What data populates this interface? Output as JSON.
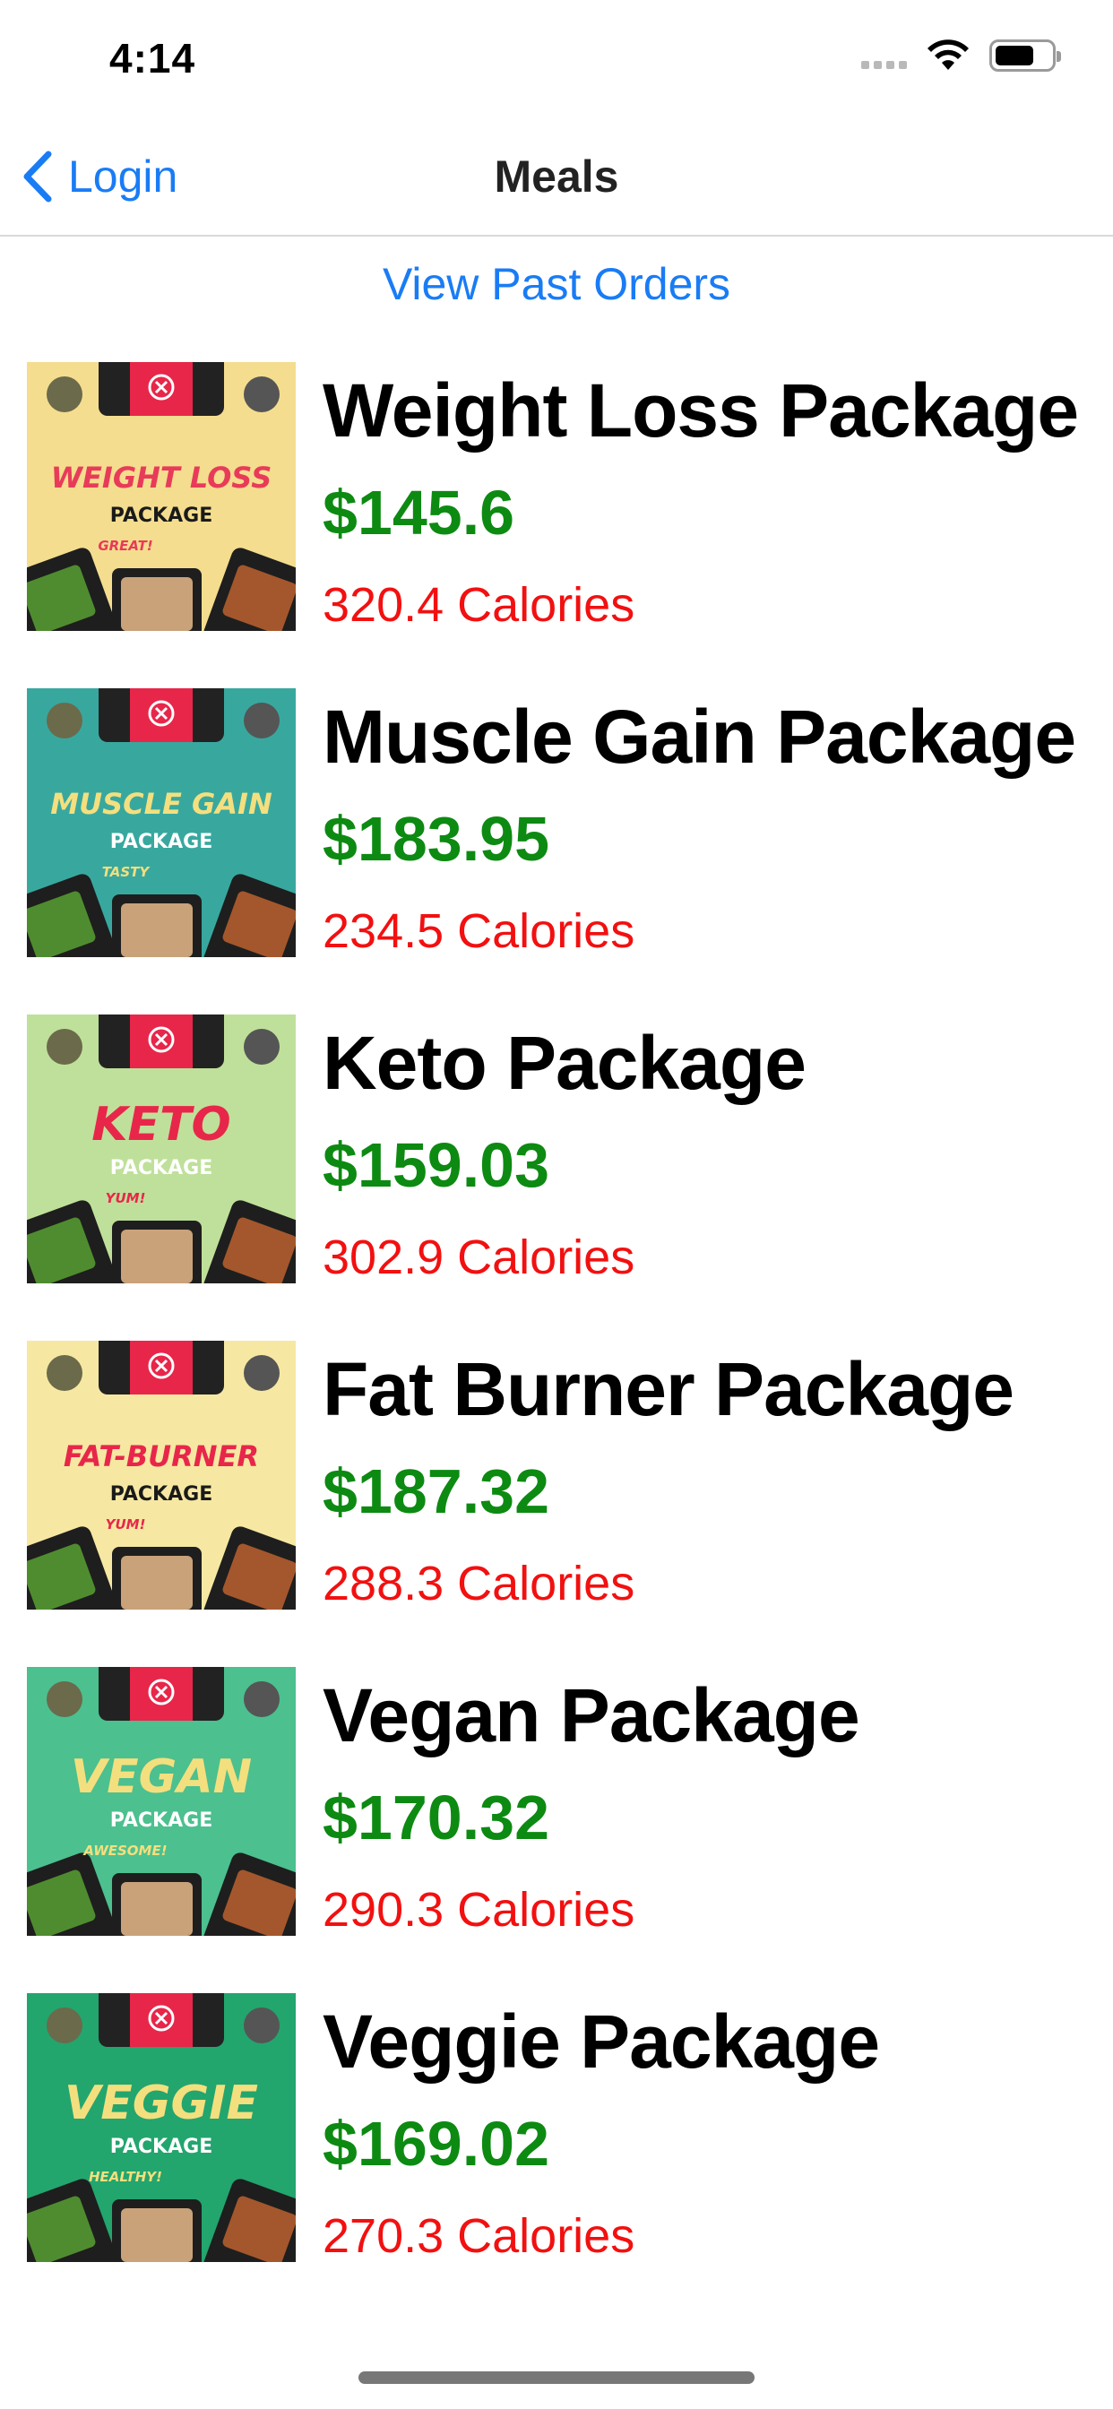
{
  "status": {
    "time": "4:14"
  },
  "nav": {
    "back_label": "Login",
    "title": "Meals"
  },
  "past_orders_label": "View Past Orders",
  "meals": [
    {
      "name": "Weight Loss Package",
      "price": "$145.6",
      "calories": "320.4 Calories",
      "image": {
        "title": "WEIGHT LOSS",
        "subtitle": "PACKAGE",
        "note": "GREAT!",
        "bg": "#f4dd8e",
        "title_color": "#e83b59",
        "sub_color": "#1a1a1a"
      }
    },
    {
      "name": "Muscle Gain Package",
      "price": "$183.95",
      "calories": "234.5 Calories",
      "image": {
        "title": "MUSCLE GAIN",
        "subtitle": "PACKAGE",
        "note": "TASTY",
        "bg": "#38a89f",
        "title_color": "#f4df7e",
        "sub_color": "#ffffff"
      }
    },
    {
      "name": "Keto Package",
      "price": "$159.03",
      "calories": "302.9 Calories",
      "image": {
        "title": "KETO",
        "subtitle": "PACKAGE",
        "note": "YUM!",
        "bg": "#bfe09a",
        "title_color": "#e8264a",
        "sub_color": "#ffffff"
      }
    },
    {
      "name": "Fat Burner Package",
      "price": "$187.32",
      "calories": "288.3 Calories",
      "image": {
        "title": "FAT-BURNER",
        "subtitle": "PACKAGE",
        "note": "YUM!",
        "bg": "#f6e8a2",
        "title_color": "#e8264a",
        "sub_color": "#1a1a1a"
      }
    },
    {
      "name": "Vegan Package",
      "price": "$170.32",
      "calories": "290.3 Calories",
      "image": {
        "title": "VEGAN",
        "subtitle": "PACKAGE",
        "note": "AWESOME!",
        "bg": "#4cc08f",
        "title_color": "#f4df7e",
        "sub_color": "#ffffff"
      }
    },
    {
      "name": "Veggie Package",
      "price": "$169.02",
      "calories": "270.3 Calories",
      "image": {
        "title": "VEGGIE",
        "subtitle": "PACKAGE",
        "note": "HEALTHY!",
        "bg": "#23a56e",
        "title_color": "#f4df7e",
        "sub_color": "#ffffff"
      }
    }
  ],
  "colors": {
    "link": "#1a7cf5",
    "price": "#0d8a12",
    "calories": "#f21010"
  },
  "icons": {
    "back": "chevron-left-icon",
    "wifi": "wifi-icon",
    "battery": "battery-icon",
    "signal": "cellular-signal-icon"
  }
}
